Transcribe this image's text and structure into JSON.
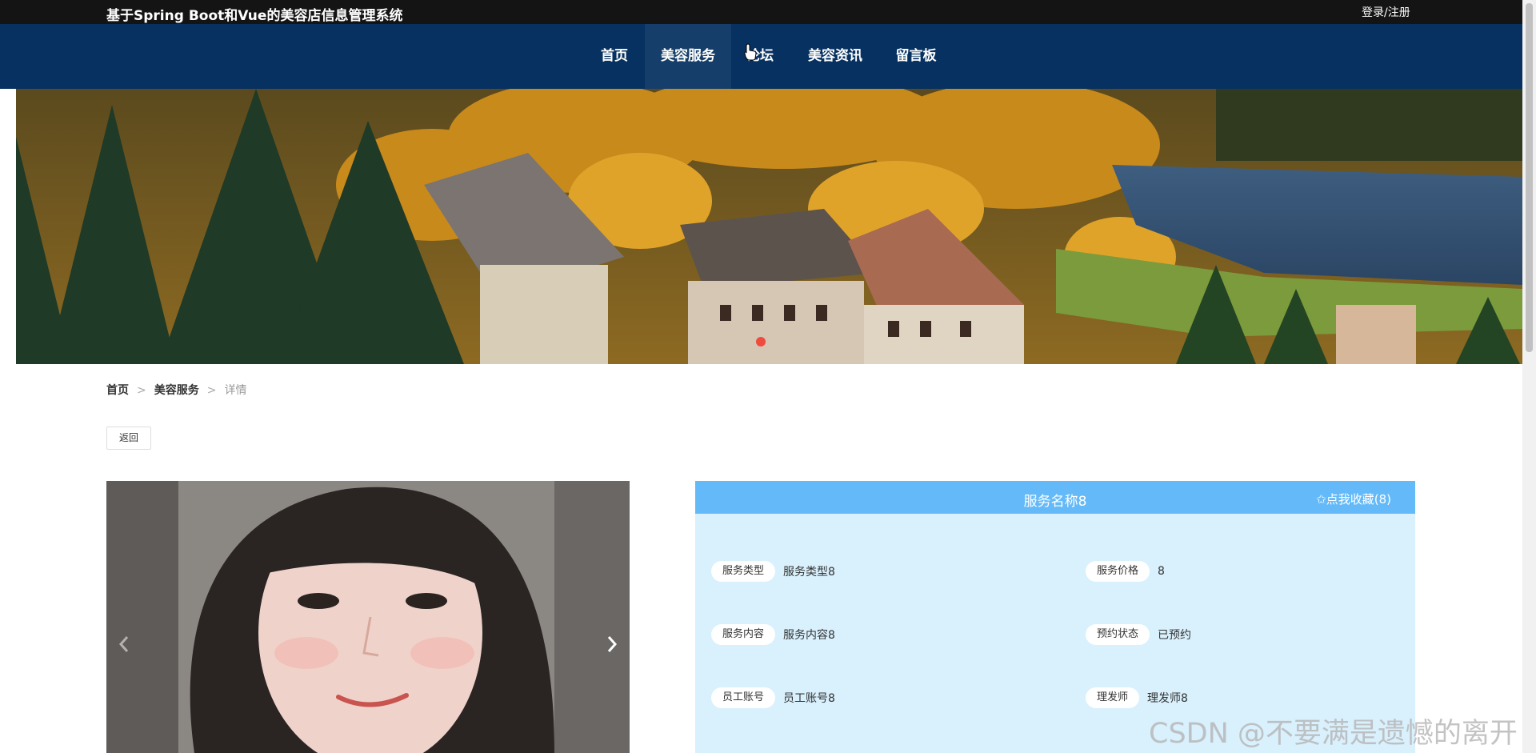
{
  "topbar": {
    "site_title": "基于Spring Boot和Vue的美容店信息管理系统",
    "login_label": "登录/注册"
  },
  "nav": {
    "items": [
      {
        "label": "首页",
        "active": false
      },
      {
        "label": "美容服务",
        "active": true
      },
      {
        "label": "论坛",
        "active": false
      },
      {
        "label": "美容资讯",
        "active": false
      },
      {
        "label": "留言板",
        "active": false
      }
    ]
  },
  "breadcrumb": {
    "home": "首页",
    "section": "美容服务",
    "current": "详情",
    "separator": ">"
  },
  "back_button": "返回",
  "detail": {
    "title": "服务名称8",
    "favorite_label": "✩点我收藏(8)",
    "fields": [
      {
        "label": "服务类型",
        "value": "服务类型8"
      },
      {
        "label": "服务价格",
        "value": "8"
      },
      {
        "label": "服务内容",
        "value": "服务内容8"
      },
      {
        "label": "预约状态",
        "value": "已预约"
      },
      {
        "label": "员工账号",
        "value": "员工账号8"
      },
      {
        "label": "理发师",
        "value": "理发师8"
      }
    ]
  },
  "icons": {
    "prev": "chevron-left-icon",
    "next": "chevron-right-icon",
    "cursor": "hand-cursor-icon"
  },
  "colors": {
    "topbar": "#141414",
    "navbar": "#063160",
    "nav_active": "#153f6a",
    "panel_header": "#64baf8",
    "panel_body": "#d9f0fd",
    "banner_dot": "#f04b3d"
  },
  "watermark": "CSDN @不要满是遗憾的离开"
}
